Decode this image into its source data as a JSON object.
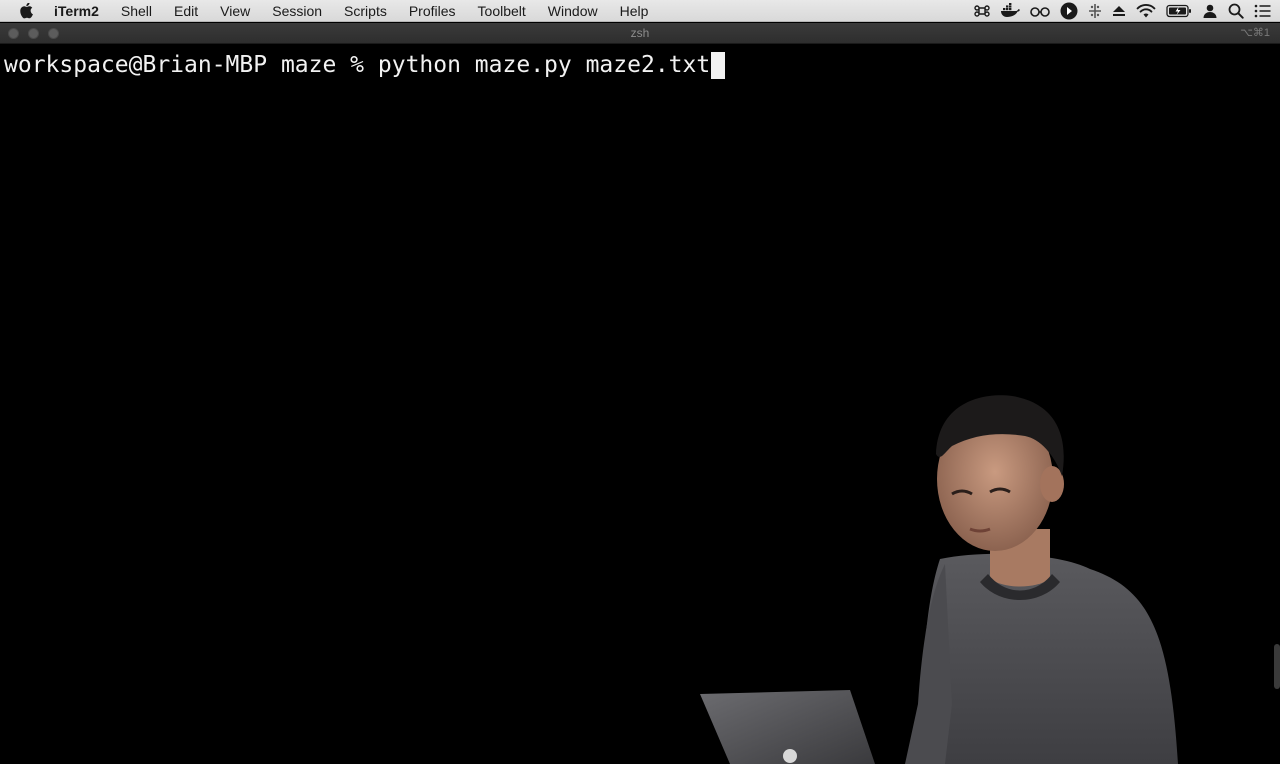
{
  "menubar": {
    "app_name": "iTerm2",
    "items": [
      "Shell",
      "Edit",
      "View",
      "Session",
      "Scripts",
      "Profiles",
      "Toolbelt",
      "Window",
      "Help"
    ],
    "status_icons": [
      "command-icon",
      "docker-icon",
      "glasses-icon",
      "play-circle-icon",
      "plus-grid-icon",
      "eject-icon",
      "wifi-icon",
      "battery-icon",
      "user-icon",
      "spotlight-search-icon",
      "notification-center-icon"
    ]
  },
  "window": {
    "title": "zsh",
    "shortcut": "⌥⌘1"
  },
  "terminal": {
    "prompt": "workspace@Brian-MBP maze % ",
    "command": "python maze.py maze2.txt"
  },
  "colors": {
    "terminal_bg": "#000000",
    "terminal_fg": "#f2f2f2",
    "menubar_bg": "#dcdcdc"
  }
}
